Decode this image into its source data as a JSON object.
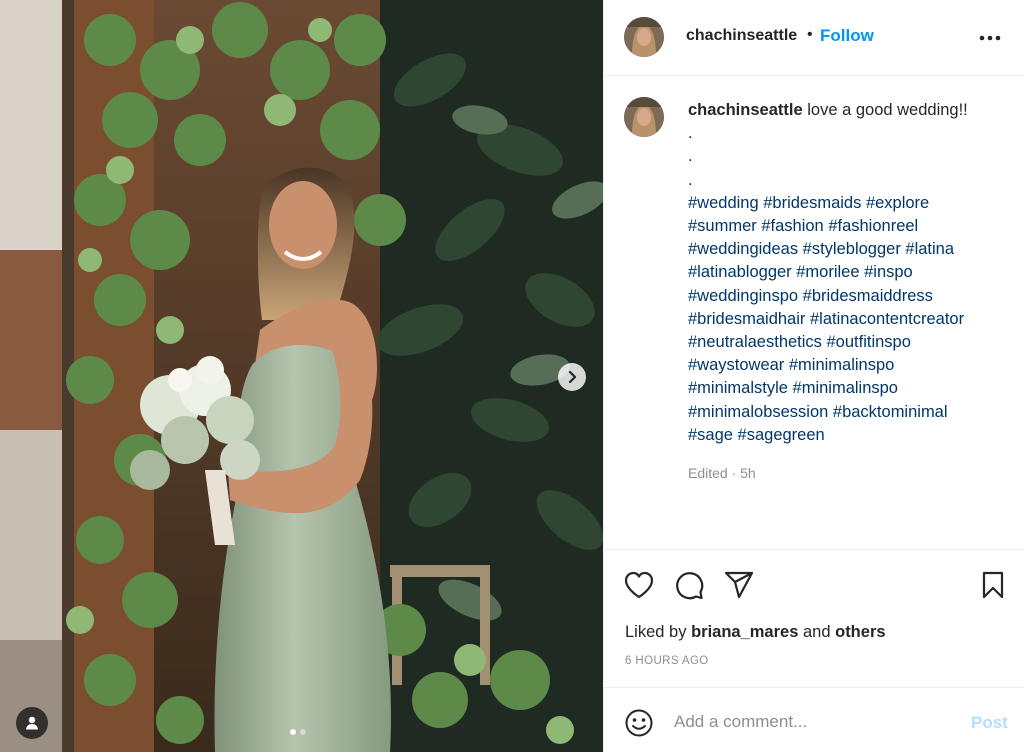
{
  "post": {
    "username": "chachinseattle",
    "separator": "•",
    "follow_label": "Follow",
    "more_icon": "more-horizontal-icon",
    "caption_text": "love a good wedding!!",
    "caption_dots": [
      ".",
      ".",
      "."
    ],
    "hashtag_lines": [
      "#wedding #bridesmaids #explore",
      "#summer #fashion #fashionreel",
      "#weddingideas #styleblogger #latina",
      "#latinablogger #morilee #inspo",
      "#weddinginspo #bridesmaiddress",
      "#bridesmaidhair #latinacontentcreator",
      "#neutralaesthetics #outfitinspo",
      "#waystowear #minimalinspo",
      "#minimalstyle #minimalinspo",
      "#minimalobsession #backtominimal",
      "#sage #sagegreen"
    ],
    "edited": "Edited · 5h"
  },
  "actions": {
    "like_icon": "heart-icon",
    "comment_icon": "comment-icon",
    "share_icon": "share-icon",
    "save_icon": "bookmark-icon",
    "liked_prefix": "Liked by",
    "liked_user": "briana_mares",
    "liked_and": "and",
    "liked_others": "others",
    "time_ago": "6 HOURS AGO"
  },
  "comment": {
    "emoji_icon": "smiley-icon",
    "placeholder": "Add a comment...",
    "post_label": "Post"
  },
  "media": {
    "next_icon": "chevron-right-icon",
    "tag_icon": "user-tag-icon",
    "slide_count": 2,
    "active_slide": 1
  },
  "colors": {
    "accent": "#0095f6",
    "hashtag": "#00376b",
    "muted": "#8e8e8e",
    "post_disabled": "#b2dffc"
  }
}
